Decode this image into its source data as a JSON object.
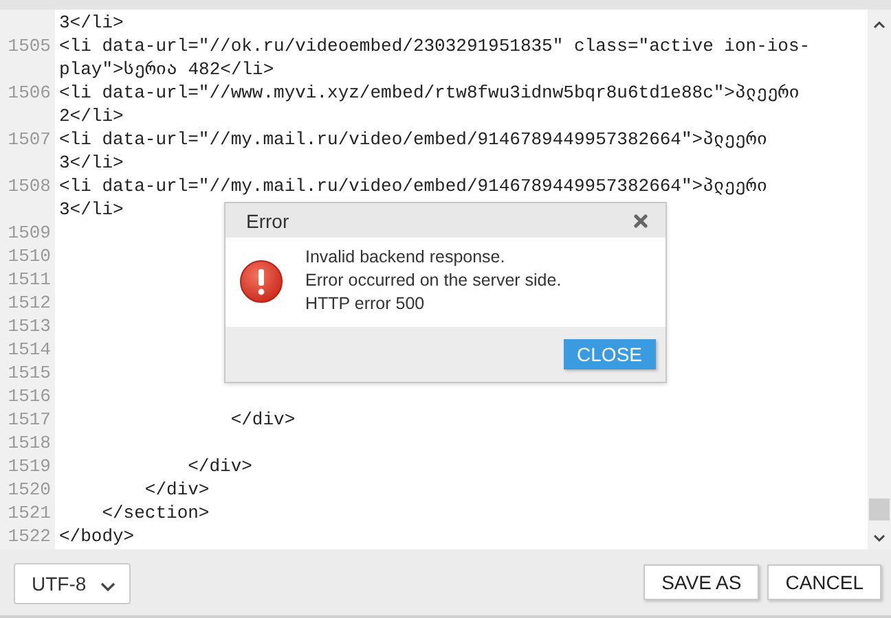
{
  "editor": {
    "lines": [
      {
        "text": "3</li>"
      },
      {
        "number": "1505",
        "text": "<li data-url=\"//ok.ru/videoembed/2303291951835\" class=\"active ion-ios-"
      },
      {
        "text": "play\">სერია 482</li>"
      },
      {
        "number": "1506",
        "text": "<li data-url=\"//www.myvi.xyz/embed/rtw8fwu3idnw5bqr8u6td1e88c\">პლეერი"
      },
      {
        "text": "2</li>"
      },
      {
        "number": "1507",
        "text": "<li data-url=\"//my.mail.ru/video/embed/9146789449957382664\">პლეერი"
      },
      {
        "text": "3</li>"
      },
      {
        "number": "1508",
        "text": "<li data-url=\"//my.mail.ru/video/embed/9146789449957382664\">პლეერი"
      },
      {
        "text": "3</li>"
      },
      {
        "number": "1509"
      },
      {
        "number": "1510"
      },
      {
        "number": "1511"
      },
      {
        "number": "1512"
      },
      {
        "number": "1513"
      },
      {
        "number": "1514"
      },
      {
        "number": "1515"
      },
      {
        "number": "1516"
      },
      {
        "number": "1517",
        "text": "                </div>"
      },
      {
        "number": "1518"
      },
      {
        "number": "1519",
        "text": "            </div>"
      },
      {
        "number": "1520",
        "text": "        </div>"
      },
      {
        "number": "1521",
        "text": "    </section>"
      },
      {
        "number": "1522",
        "text": "</body>"
      }
    ]
  },
  "dialog": {
    "title": "Error",
    "message": [
      "Invalid backend response.",
      "Error occurred on the server side.",
      "HTTP error 500"
    ],
    "button": "CLOSE"
  },
  "footer": {
    "encoding": "UTF-8",
    "buttons": [
      "SAVE AS",
      "CANCEL"
    ]
  }
}
